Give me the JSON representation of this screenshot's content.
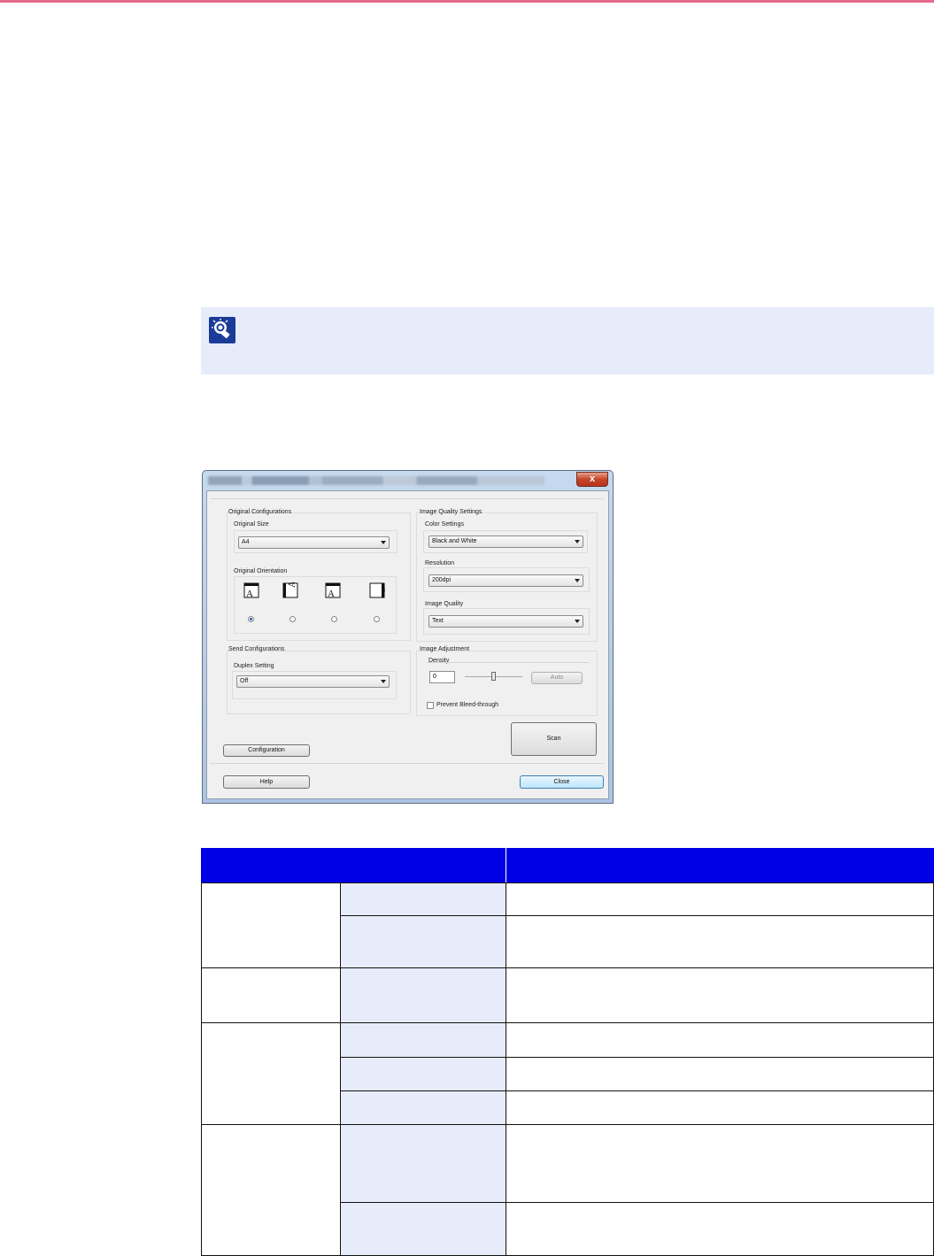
{
  "note": {
    "icon": "lightbulb-hint-icon"
  },
  "dialog": {
    "close_glyph": "x",
    "original_configurations": {
      "title": "Original Configurations",
      "size_label": "Original Size",
      "size_value": "A4",
      "orientation_label": "Original Orientation",
      "orientation_glyph": "A",
      "orientation_selected": 0
    },
    "image_quality_settings": {
      "title": "Image Quality Settings",
      "color_label": "Color Settings",
      "color_value": "Black and White",
      "resolution_label": "Resolution",
      "resolution_value": "200dpi",
      "quality_label": "Image Quality",
      "quality_value": "Text"
    },
    "send_configurations": {
      "title": "Send Configurations",
      "duplex_label": "Duplex Setting",
      "duplex_value": "Off"
    },
    "image_adjustment": {
      "title": "Image Adjustment",
      "density_label": "Density",
      "density_value": "0",
      "auto_label": "Auto",
      "bleed_label": "Prevent Bleed-through",
      "bleed_checked": false
    },
    "buttons": {
      "scan": "Scan",
      "configuration": "Configuration",
      "help": "Help",
      "close": "Close"
    }
  },
  "colors": {
    "table_header": "#0000e6",
    "table_light": "#e7ecfa",
    "note_bg": "#e7ecfa",
    "top_rule": "#e66a8e"
  }
}
